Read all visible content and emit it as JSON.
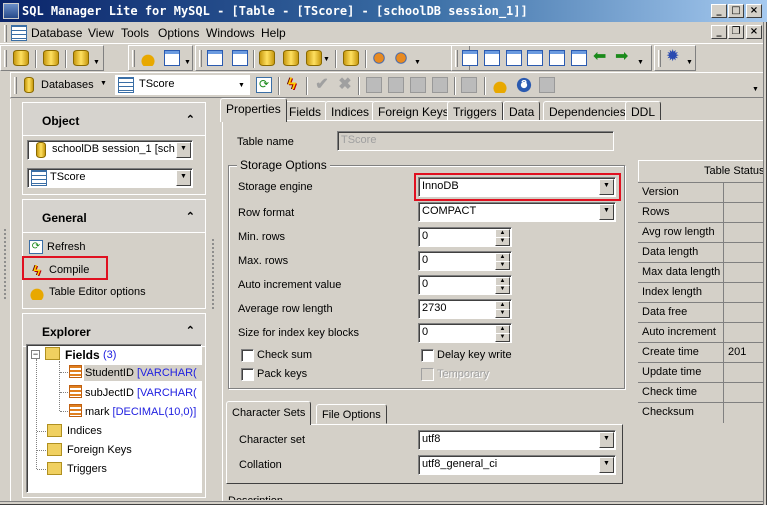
{
  "window": {
    "title": "SQL Manager Lite for MySQL - [Table - [TScore] - [schoolDB session_1]]",
    "caption_buttons": {
      "minimize": "_",
      "maximize": "□",
      "close": "×"
    },
    "mdi_buttons": {
      "minimize": "_",
      "restore": "❐",
      "close": "×"
    }
  },
  "menubar": {
    "items": [
      {
        "label": "Database",
        "accel": "D"
      },
      {
        "label": "View",
        "accel": "V"
      },
      {
        "label": "Tools",
        "accel": "T"
      },
      {
        "label": "Options",
        "accel": "O"
      },
      {
        "label": "Windows",
        "accel": "W"
      },
      {
        "label": "Help",
        "accel": "H"
      }
    ]
  },
  "toolbar_main": {
    "icons": [
      "register-database-icon",
      "unregister-database-icon",
      "database-properties-icon",
      "preferences-icon",
      "checklist-icon",
      "sql-editor-icon",
      "new-query-icon",
      "connect-icon",
      "execute-icon",
      "new-object-icon",
      "export-icon",
      "user-manager-icon",
      "grant-manager-icon",
      "cascade-windows-icon",
      "tile-windows-icon",
      "tile-horizontal-icon",
      "tile-vertical-icon",
      "restore-window-icon",
      "close-window-icon",
      "previous-window-icon",
      "next-window-icon",
      "plugins-gear-icon"
    ]
  },
  "toolbar_object": {
    "databases_label": "Databases",
    "table_combo_value": "TScore"
  },
  "left_panel": {
    "object": {
      "title": "Object",
      "database_combo": "schoolDB session_1 [sch",
      "table_combo": "TScore"
    },
    "general": {
      "title": "General",
      "items": [
        "Refresh",
        "Compile",
        "Table Editor options"
      ]
    },
    "explorer": {
      "title": "Explorer",
      "fields_label": "Fields",
      "fields_count": "(3)",
      "fields": [
        {
          "name": "StudentID",
          "type": "[VARCHAR("
        },
        {
          "name": "subJectID",
          "type": "[VARCHAR("
        },
        {
          "name": "mark",
          "type": "[DECIMAL(10,0)]"
        }
      ],
      "nodes": [
        "Indices",
        "Foreign Keys",
        "Triggers"
      ]
    }
  },
  "tabs": [
    "Properties",
    "Fields",
    "Indices",
    "Foreign Keys",
    "Triggers",
    "Data",
    "Dependencies",
    "DDL"
  ],
  "active_tab": "Properties",
  "properties": {
    "table_name_label": "Table name",
    "table_name_value": "TScore",
    "storage_group_title": "Storage Options",
    "storage_engine_label": "Storage engine",
    "storage_engine_value": "InnoDB",
    "row_format_label": "Row format",
    "row_format_value": "COMPACT",
    "min_rows_label": "Min. rows",
    "min_rows_value": "0",
    "max_rows_label": "Max. rows",
    "max_rows_value": "0",
    "auto_inc_label": "Auto increment value",
    "auto_inc_value": "0",
    "avg_row_label": "Average row length",
    "avg_row_value": "2730",
    "index_block_label": "Size for index key blocks",
    "index_block_value": "0",
    "check_sum_label": "Check sum",
    "pack_keys_label": "Pack keys",
    "delay_key_write_label": "Delay key write",
    "temporary_label": "Temporary",
    "subtabs": [
      "Character Sets",
      "File Options"
    ],
    "charset_label": "Character set",
    "charset_value": "utf8",
    "collation_label": "Collation",
    "collation_value": "utf8_general_ci",
    "description_label": "Description"
  },
  "table_status": {
    "title": "Table Status",
    "rows": [
      {
        "key": "Version",
        "value": ""
      },
      {
        "key": "Rows",
        "value": ""
      },
      {
        "key": "Avg row length",
        "value": ""
      },
      {
        "key": "Data length",
        "value": ""
      },
      {
        "key": "Max data length",
        "value": ""
      },
      {
        "key": "Index length",
        "value": ""
      },
      {
        "key": "Data free",
        "value": ""
      },
      {
        "key": "Auto increment",
        "value": ""
      },
      {
        "key": "Create time",
        "value": "201"
      },
      {
        "key": "Update time",
        "value": ""
      },
      {
        "key": "Check time",
        "value": ""
      },
      {
        "key": "Checksum",
        "value": ""
      }
    ]
  },
  "colors": {
    "highlight_red": "#e01020",
    "type_blue": "#2020e0"
  }
}
